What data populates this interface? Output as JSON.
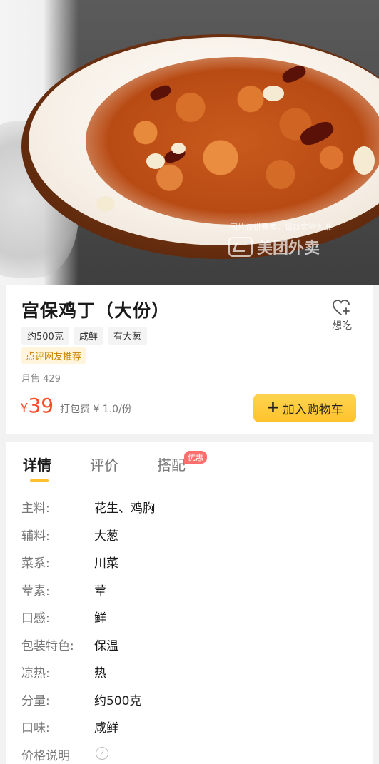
{
  "hero": {
    "watermark_note": "图片仅供参考，请以实物为准",
    "watermark_brand": "美团外卖"
  },
  "product": {
    "title": "宫保鸡丁（大份）",
    "want_label": "想吃",
    "tags": [
      "约500克",
      "咸鲜",
      "有大葱"
    ],
    "recommend_badge": "点评网友推荐",
    "monthly_sales": "月售 429",
    "price_symbol": "¥",
    "price": "39",
    "packing_fee": "打包费 ¥ 1.0/份",
    "add_to_cart_label": "加入购物车",
    "colors": {
      "price": "#ff4a26",
      "cart_button": "#ffc22c"
    }
  },
  "tabs": [
    {
      "label": "详情",
      "active": true
    },
    {
      "label": "评价",
      "active": false
    },
    {
      "label": "搭配",
      "active": false,
      "badge": "优惠"
    }
  ],
  "details": [
    {
      "key": "主料:",
      "value": "花生、鸡胸"
    },
    {
      "key": "辅料:",
      "value": "大葱"
    },
    {
      "key": "菜系:",
      "value": "川菜"
    },
    {
      "key": "荤素:",
      "value": "荤"
    },
    {
      "key": "口感:",
      "value": "鲜"
    },
    {
      "key": "包装特色:",
      "value": "保温"
    },
    {
      "key": "凉热:",
      "value": "热"
    },
    {
      "key": "分量:",
      "value": "约500克"
    },
    {
      "key": "口味:",
      "value": "咸鲜"
    },
    {
      "key": "价格说明",
      "value": ""
    }
  ]
}
